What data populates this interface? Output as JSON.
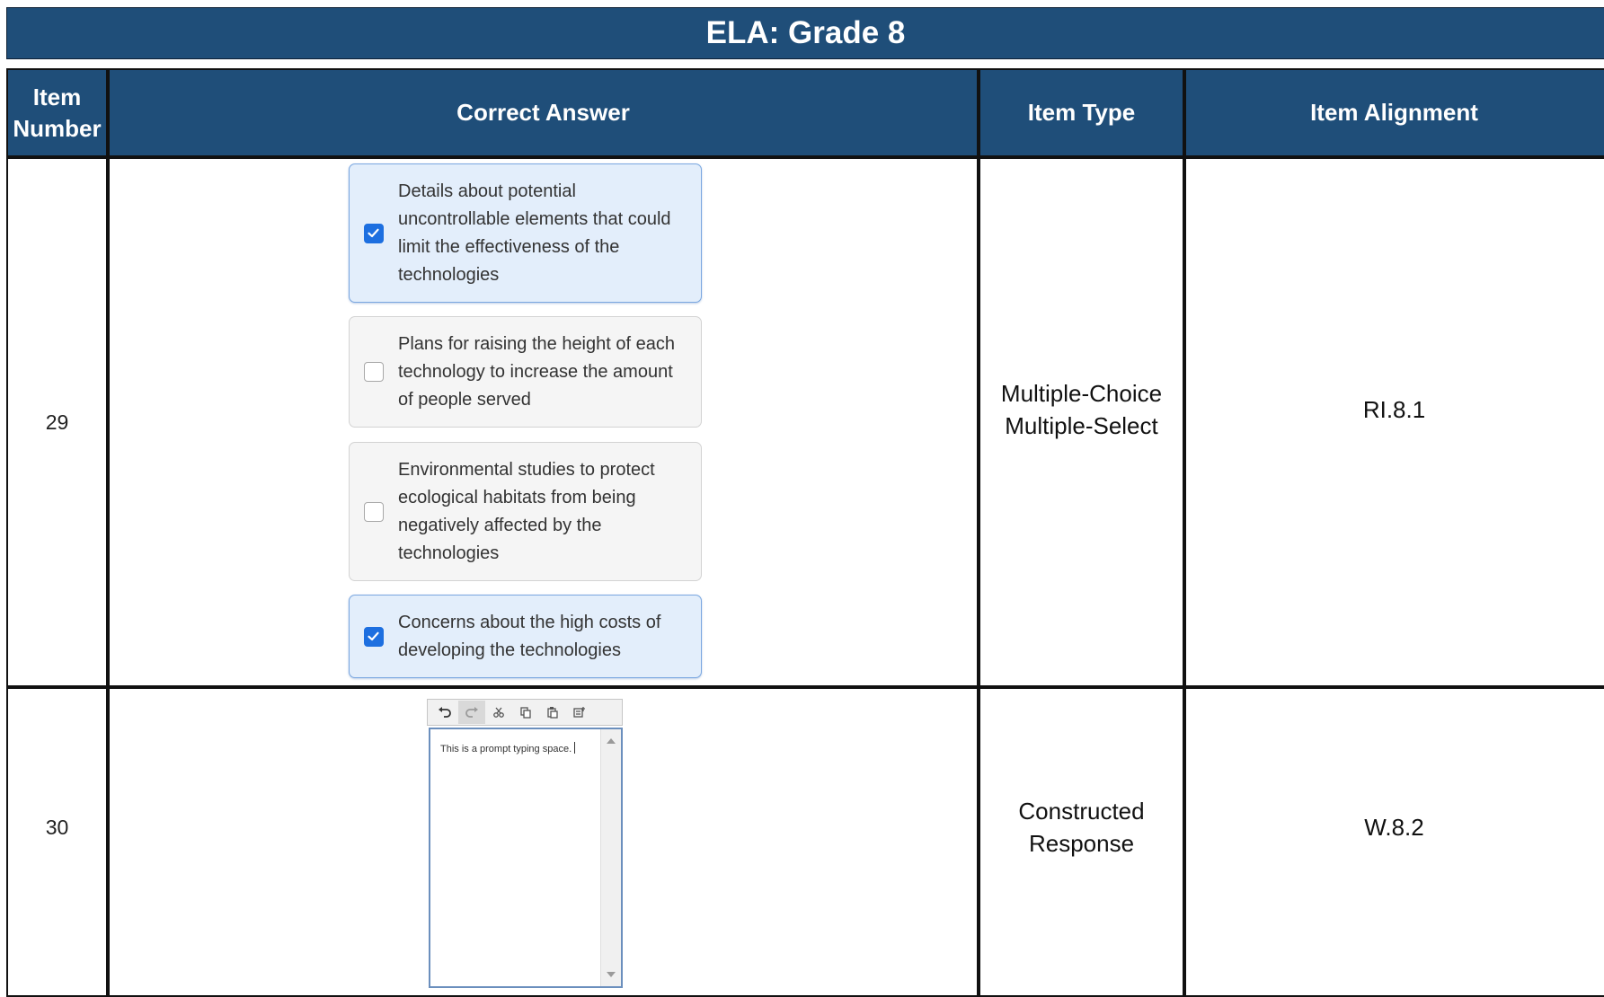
{
  "title": "ELA: Grade 8",
  "headers": {
    "item_number": "Item Number",
    "correct_answer": "Correct Answer",
    "item_type": "Item Type",
    "item_alignment": "Item Alignment"
  },
  "rows": [
    {
      "number": "29",
      "options": [
        {
          "text": "Details about potential uncontrollable elements that could limit the effectiveness of the technologies",
          "checked": true
        },
        {
          "text": "Plans for raising the height of each technology to increase the amount of people served",
          "checked": false
        },
        {
          "text": "Environmental studies to protect ecological habitats from being negatively affected by the technologies",
          "checked": false
        },
        {
          "text": "Concerns about the high costs of developing the technologies",
          "checked": true
        }
      ],
      "item_type": "Multiple-Choice Multiple-Select",
      "alignment": "RI.8.1"
    },
    {
      "number": "30",
      "editor": {
        "typed_text": "This is a prompt typing space.",
        "toolbar": [
          "undo-icon",
          "redo-icon",
          "cut-icon",
          "copy-icon",
          "paste-icon",
          "special-characters-icon"
        ]
      },
      "item_type": "Constructed Response",
      "alignment": "W.8.2"
    }
  ],
  "colors": {
    "header_bg": "#1f4e79",
    "selected_option_bg": "#e3eefb",
    "checkbox_checked": "#1d6fe0"
  }
}
